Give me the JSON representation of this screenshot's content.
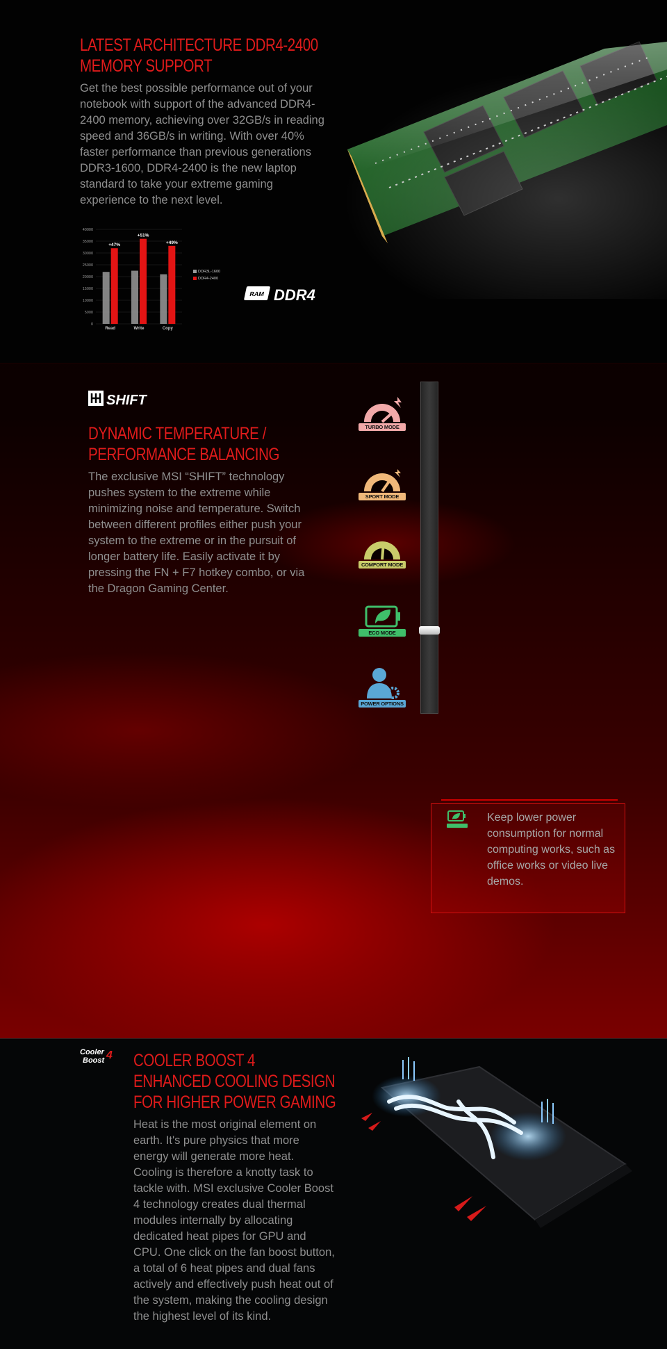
{
  "ddr4": {
    "title_line1": "LATEST ARCHITECTURE DDR4-2400",
    "title_line2": "MEMORY SUPPORT",
    "body": "Get the best possible performance out of your notebook with support of the advanced DDR4-2400 memory, achieving over 32GB/s in reading speed and 36GB/s in writing. With over 40% faster performance than previous generations DDR3-1600, DDR4-2400 is the new laptop standard to take your extreme gaming experience to the next level.",
    "badge_text": "DDR4",
    "badge_icon_text": "RAM",
    "chart_data": {
      "type": "bar",
      "categories": [
        "Read",
        "Write",
        "Copy"
      ],
      "series": [
        {
          "name": "DDR3L-1600",
          "values": [
            22000,
            22500,
            21000
          ],
          "color": "#9a9a9a"
        },
        {
          "name": "DDR4-2400",
          "values": [
            32000,
            36000,
            33000
          ],
          "color": "#e31414"
        }
      ],
      "annotations": [
        "+47%",
        "+51%",
        "+49%"
      ],
      "yticks": [
        "40000",
        "35000",
        "30000",
        "25000",
        "20000",
        "15000",
        "10000",
        "5000",
        "0"
      ],
      "ylim": [
        0,
        40000
      ],
      "legend_position": "right"
    }
  },
  "shift": {
    "logo_text": "SHIFT",
    "title_line1": "DYNAMIC TEMPERATURE /",
    "title_line2": "PERFORMANCE BALANCING",
    "body": "The exclusive MSI “SHIFT” technology pushes system to the extreme while minimizing noise and temperature. Switch between different profiles either push your system to the extreme or in the pursuit of longer battery life. Easily activate it by pressing the FN + F7 hotkey combo, or via the Dragon Gaming Center.",
    "modes": [
      {
        "label": "TURBO MODE",
        "icon": "turbo-gauge-icon",
        "color": "#f2a9a9"
      },
      {
        "label": "SPORT MODE",
        "icon": "sport-gauge-icon",
        "color": "#f0b87a"
      },
      {
        "label": "COMFORT MODE",
        "icon": "comfort-gauge-icon",
        "color": "#c9cc6a"
      },
      {
        "label": "ECO MODE",
        "icon": "battery-leaf-icon",
        "color": "#3fbf6a"
      },
      {
        "label": "POWER OPTIONS",
        "icon": "user-gear-icon",
        "color": "#5aa7d6"
      }
    ],
    "selected_mode": "ECO MODE",
    "info_text": "Keep lower power consumption for normal computing works, such as office works or video live demos.",
    "info_icon_label": "ECO MODE"
  },
  "cooler": {
    "logo_line1": "Cooler",
    "logo_line2": "Boost",
    "logo_num": "4",
    "title_line1": "COOLER BOOST 4",
    "title_line2": "ENHANCED COOLING DESIGN",
    "title_line3": "FOR HIGHER POWER GAMING",
    "body": "Heat is the most original element on earth. It's pure physics that more energy will generate more heat. Cooling is therefore a knotty task to tackle with. MSI exclusive Cooler Boost 4 technology creates dual thermal modules internally by allocating dedicated heat pipes for GPU and CPU. One click on the fan boost button, a total of 6 heat pipes and dual fans actively and effectively push heat out of the system, making the cooling design the highest level of its kind."
  }
}
